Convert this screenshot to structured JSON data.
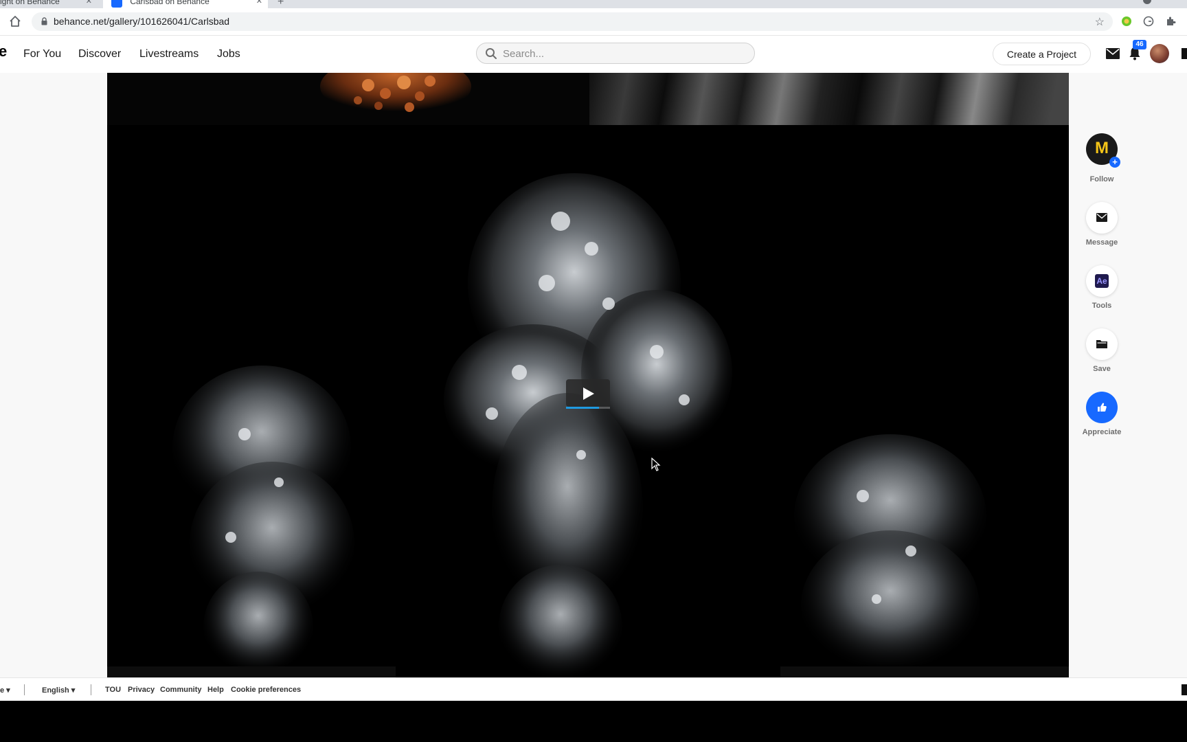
{
  "browser": {
    "tab1_title": "ight on Behance",
    "tab2_title": "Carlsbad on Behance",
    "url": "behance.net/gallery/101626041/Carlsbad"
  },
  "nav": {
    "brand": "e",
    "links": [
      "For You",
      "Discover",
      "Livestreams",
      "Jobs"
    ],
    "search_placeholder": "Search...",
    "create_button": "Create a Project",
    "notification_count": "46"
  },
  "video": {
    "playing": false,
    "progress": 0.75
  },
  "rail": {
    "owner_initial": "M",
    "follow": "Follow",
    "message": "Message",
    "tools_badge": "Ae",
    "tools": "Tools",
    "save": "Save",
    "appreciate": "Appreciate"
  },
  "footer": {
    "language": "English",
    "links": [
      "TOU",
      "Privacy",
      "Community",
      "Help",
      "Cookie preferences"
    ]
  },
  "colors": {
    "brand_blue": "#1769ff",
    "owner_avatar_letter": "#f5c518"
  }
}
